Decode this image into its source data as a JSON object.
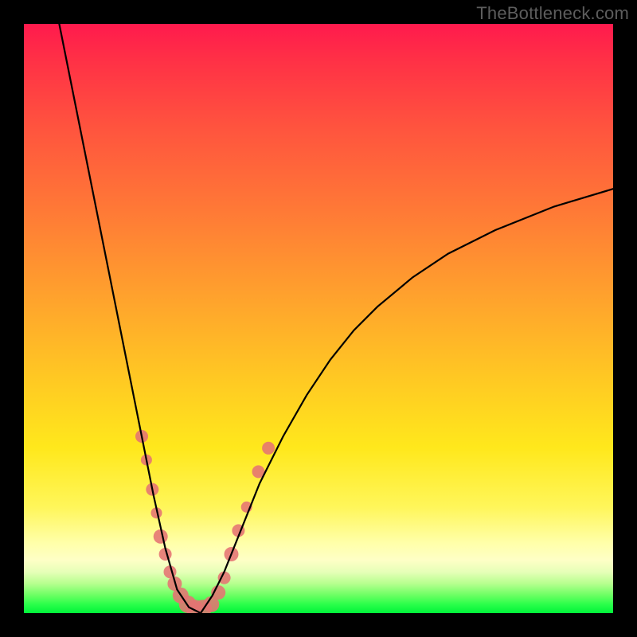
{
  "watermark": "TheBottleneck.com",
  "colors": {
    "frame": "#000000",
    "curve": "#000000",
    "marker": "#e57373",
    "gradient_top": "#ff1a4d",
    "gradient_bottom": "#00f33a"
  },
  "chart_data": {
    "type": "line",
    "title": "",
    "xlabel": "",
    "ylabel": "",
    "xlim": [
      0,
      100
    ],
    "ylim": [
      0,
      100
    ],
    "description": "V-shaped bottleneck curve over a vertical red-to-green gradient. Left branch falls steeply from x≈6 to a flat bottom near x≈25–30 at y≈0, right branch rises with decreasing slope toward x=100,y≈72. Salmon dot markers cluster along both branches in the lower ~30% of the chart.",
    "series": [
      {
        "name": "left-branch",
        "x": [
          6,
          8,
          10,
          12,
          14,
          16,
          18,
          20,
          22,
          24,
          26,
          28,
          30
        ],
        "y": [
          100,
          90,
          80,
          70,
          60,
          50,
          40,
          30,
          20,
          11,
          4,
          1,
          0
        ]
      },
      {
        "name": "right-branch",
        "x": [
          30,
          32,
          34,
          36,
          38,
          40,
          44,
          48,
          52,
          56,
          60,
          66,
          72,
          80,
          90,
          100
        ],
        "y": [
          0,
          3,
          7,
          12,
          17,
          22,
          30,
          37,
          43,
          48,
          52,
          57,
          61,
          65,
          69,
          72
        ]
      }
    ],
    "markers": {
      "name": "highlight-dots",
      "color": "#e57373",
      "radius_range_px": [
        6,
        12
      ],
      "points": [
        {
          "x": 20.0,
          "y": 30,
          "r": 8
        },
        {
          "x": 20.8,
          "y": 26,
          "r": 7
        },
        {
          "x": 21.8,
          "y": 21,
          "r": 8
        },
        {
          "x": 22.5,
          "y": 17,
          "r": 7
        },
        {
          "x": 23.2,
          "y": 13,
          "r": 9
        },
        {
          "x": 24.0,
          "y": 10,
          "r": 8
        },
        {
          "x": 24.8,
          "y": 7,
          "r": 8
        },
        {
          "x": 25.6,
          "y": 5,
          "r": 9
        },
        {
          "x": 26.6,
          "y": 3,
          "r": 10
        },
        {
          "x": 27.8,
          "y": 1.5,
          "r": 11
        },
        {
          "x": 29.0,
          "y": 0.8,
          "r": 11
        },
        {
          "x": 30.4,
          "y": 0.8,
          "r": 11
        },
        {
          "x": 31.8,
          "y": 1.5,
          "r": 10
        },
        {
          "x": 33.0,
          "y": 3.5,
          "r": 9
        },
        {
          "x": 34.0,
          "y": 6,
          "r": 8
        },
        {
          "x": 35.2,
          "y": 10,
          "r": 9
        },
        {
          "x": 36.4,
          "y": 14,
          "r": 8
        },
        {
          "x": 37.8,
          "y": 18,
          "r": 7
        },
        {
          "x": 39.8,
          "y": 24,
          "r": 8
        },
        {
          "x": 41.5,
          "y": 28,
          "r": 8
        }
      ]
    }
  }
}
